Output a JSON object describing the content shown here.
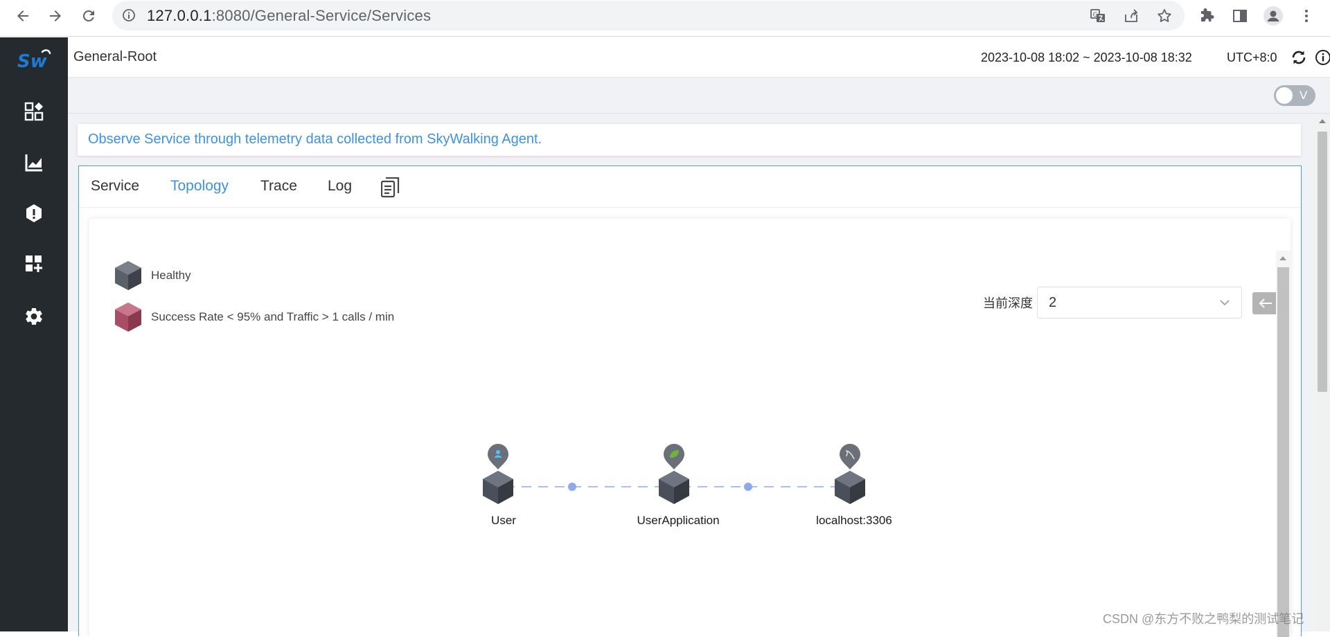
{
  "browser": {
    "url_host": "127.0.0.1",
    "url_path": ":8080/General-Service/Services"
  },
  "header": {
    "title": "General-Root",
    "time_range": "2023-10-08 18:02 ~ 2023-10-08 18:32",
    "timezone": "UTC+8:0"
  },
  "toolbar": {
    "toggle_label": "V"
  },
  "description": "Observe Service through telemetry data collected from SkyWalking Agent.",
  "tabs": [
    {
      "label": "Service"
    },
    {
      "label": "Topology"
    },
    {
      "label": "Trace"
    },
    {
      "label": "Log"
    }
  ],
  "active_tab": "Topology",
  "legend": {
    "healthy": "Healthy",
    "unhealthy": "Success Rate < 95% and Traffic > 1 calls / min"
  },
  "depth": {
    "label": "当前深度",
    "value": "2"
  },
  "topology": {
    "nodes": [
      {
        "name": "User",
        "type": "user",
        "healthy": true
      },
      {
        "name": "UserApplication",
        "type": "spring",
        "healthy": true
      },
      {
        "name": "localhost:3306",
        "type": "mysql",
        "healthy": true
      }
    ],
    "links": [
      {
        "source": "User",
        "target": "UserApplication"
      },
      {
        "source": "UserApplication",
        "target": "localhost:3306"
      }
    ]
  },
  "colors": {
    "sidebar_bg": "#252a2f",
    "accent": "#3d92e0",
    "healthy_node": "#4a505a",
    "unhealthy_node": "#a0485e",
    "link": "#8fa9ef"
  },
  "watermark": "CSDN @东方不败之鸭梨的测试笔记"
}
